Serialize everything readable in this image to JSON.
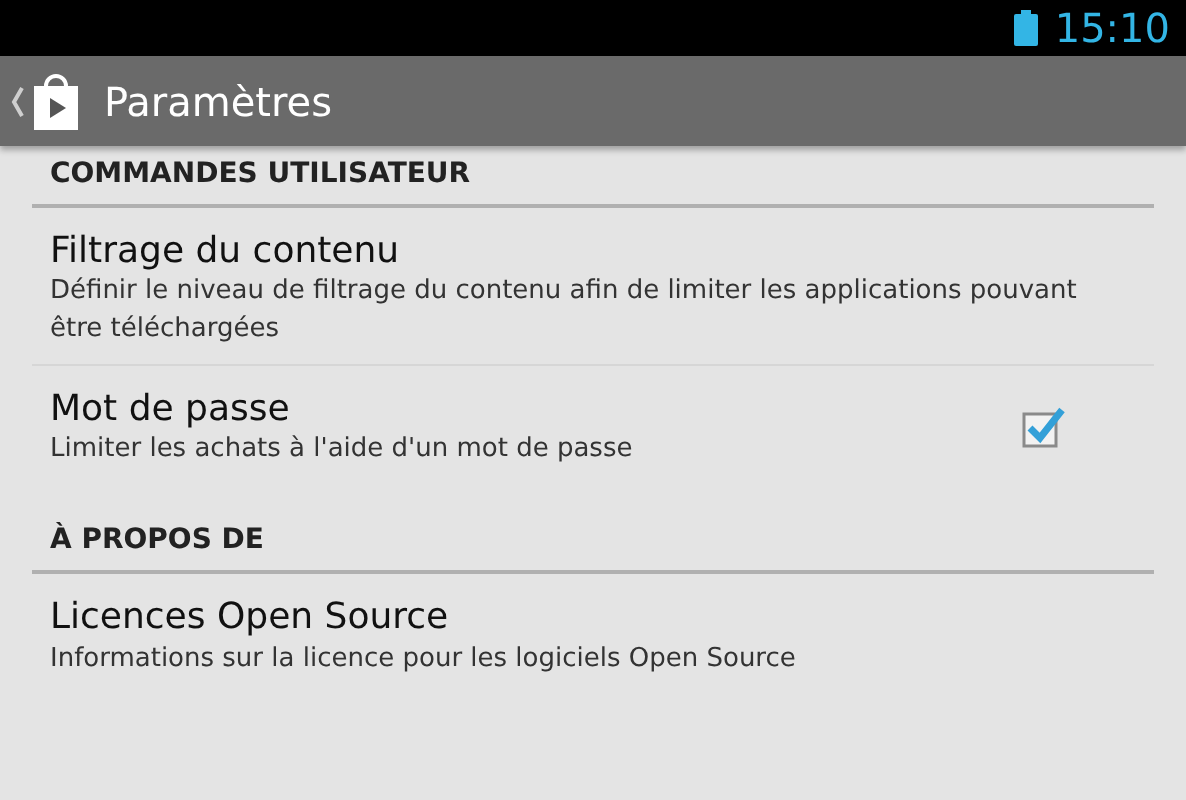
{
  "status_bar": {
    "time": "15:10"
  },
  "action_bar": {
    "title": "Paramètres"
  },
  "sections": [
    {
      "header": "COMMANDES UTILISATEUR",
      "items": [
        {
          "kind": "plain",
          "title": "Filtrage du contenu",
          "summary": "Définir le niveau de filtrage du contenu afin de limiter les applications pouvant être téléchargées"
        },
        {
          "kind": "checkbox",
          "title": "Mot de passe",
          "summary": "Limiter les achats à l'aide d'un mot de passe",
          "checked": true
        }
      ]
    },
    {
      "header": "À PROPOS DE",
      "items": [
        {
          "kind": "plain",
          "title": "Licences Open Source",
          "summary": "Informations sur la licence pour les logiciels Open Source"
        }
      ]
    }
  ]
}
